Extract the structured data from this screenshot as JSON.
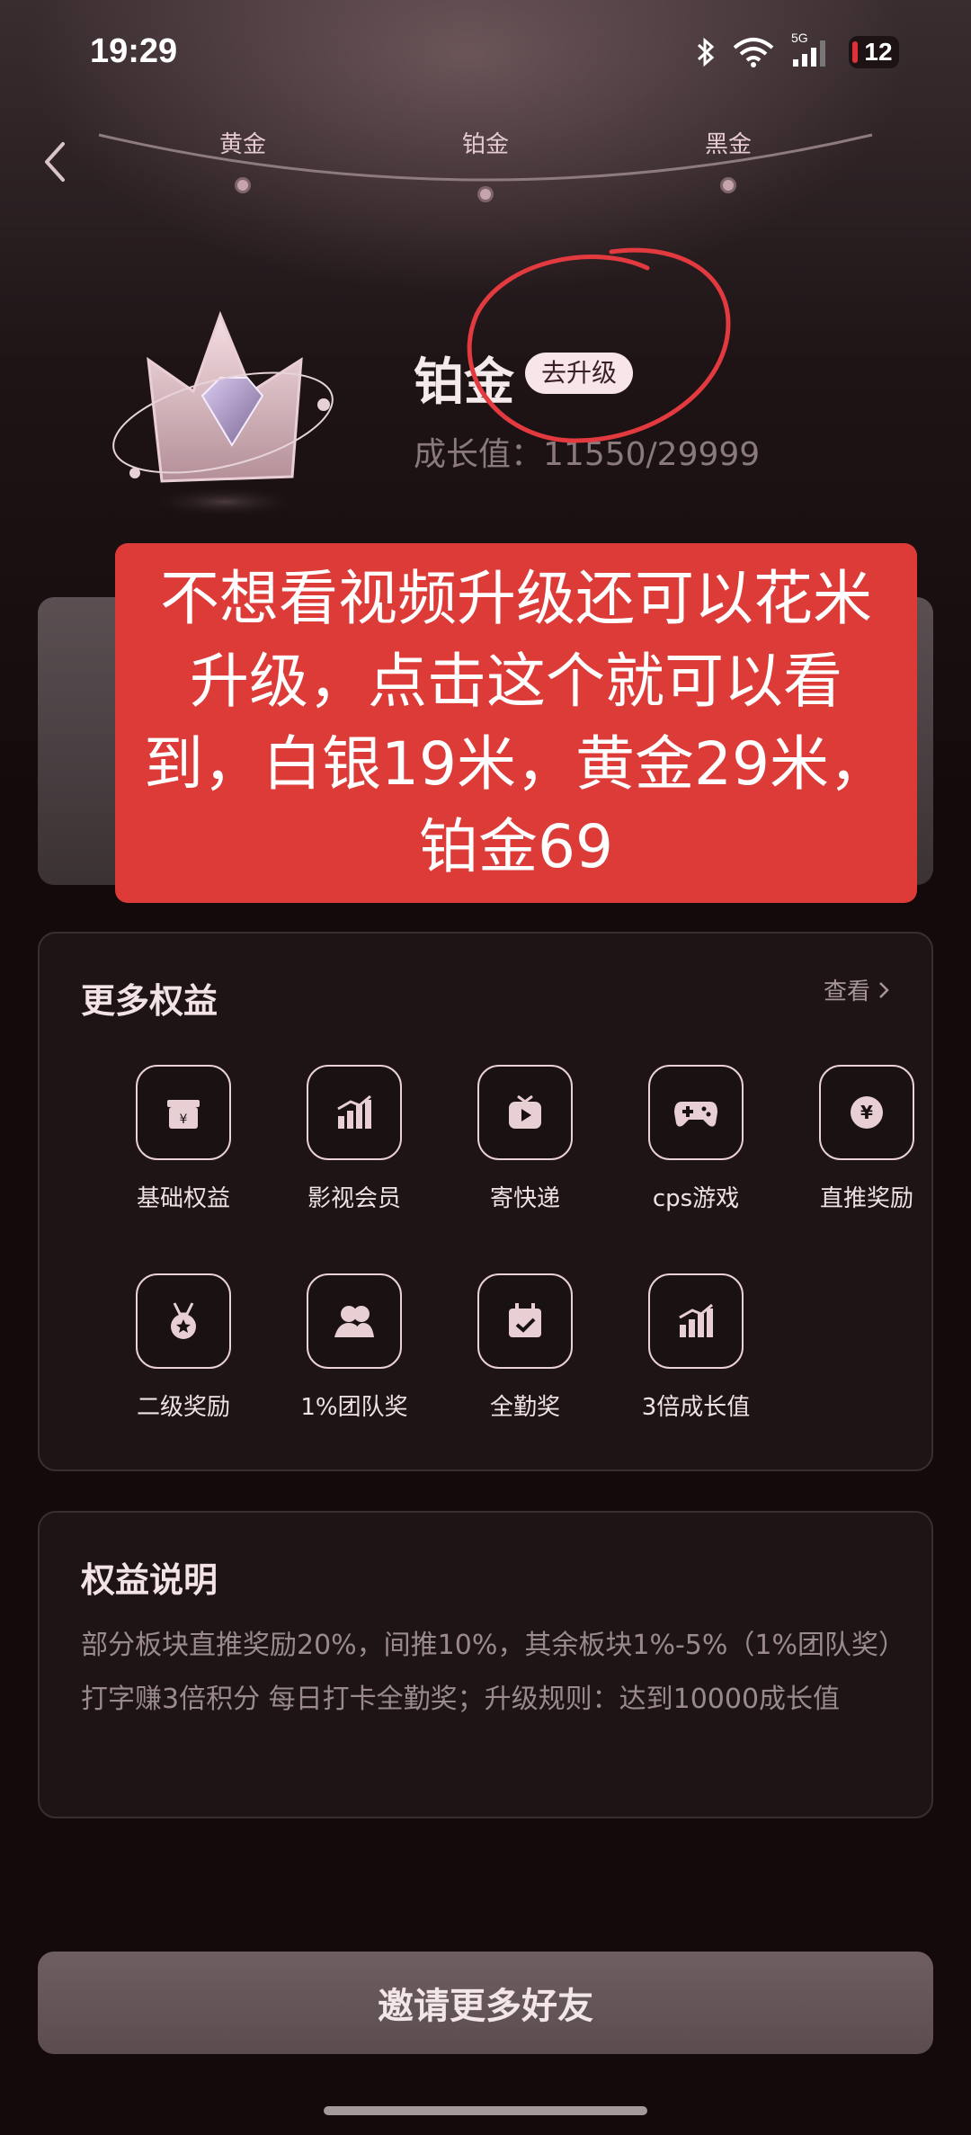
{
  "status_bar": {
    "time": "19:29",
    "network": "5G",
    "battery": "12"
  },
  "level_track": {
    "levels": [
      "黄金",
      "铂金",
      "黑金"
    ],
    "current": "铂金"
  },
  "tier": {
    "name": "铂金",
    "upgrade_label": "去升级",
    "growth_label": "成长值：",
    "growth_value": "11550/29999"
  },
  "annotation": {
    "text": "不想看视频升级还可以花米升级，点击这个就可以看到，白银19米，黄金29米，铂金69",
    "color": "#dc3b38"
  },
  "more_benefits": {
    "title": "更多权益",
    "view_label": "查看",
    "items": [
      {
        "label": "基础权益",
        "icon": "wallet-yen-icon"
      },
      {
        "label": "影视会员",
        "icon": "bar-chart-icon"
      },
      {
        "label": "寄快递",
        "icon": "tv-play-icon"
      },
      {
        "label": "cps游戏",
        "icon": "gamepad-icon"
      },
      {
        "label": "直推奖励",
        "icon": "yen-coin-icon"
      },
      {
        "label": "二级奖励",
        "icon": "medal-icon"
      },
      {
        "label": "1%团队奖",
        "icon": "team-icon"
      },
      {
        "label": "全勤奖",
        "icon": "calendar-check-icon"
      },
      {
        "label": "3倍成长值",
        "icon": "growth-chart-icon"
      }
    ]
  },
  "description": {
    "title": "权益说明",
    "text": "部分板块直推奖励20%，间推10%，其余板块1%-5%（1%团队奖）打字赚3倍积分 每日打卡全勤奖；升级规则：达到10000成长值"
  },
  "invite_button": {
    "label": "邀请更多好友"
  }
}
